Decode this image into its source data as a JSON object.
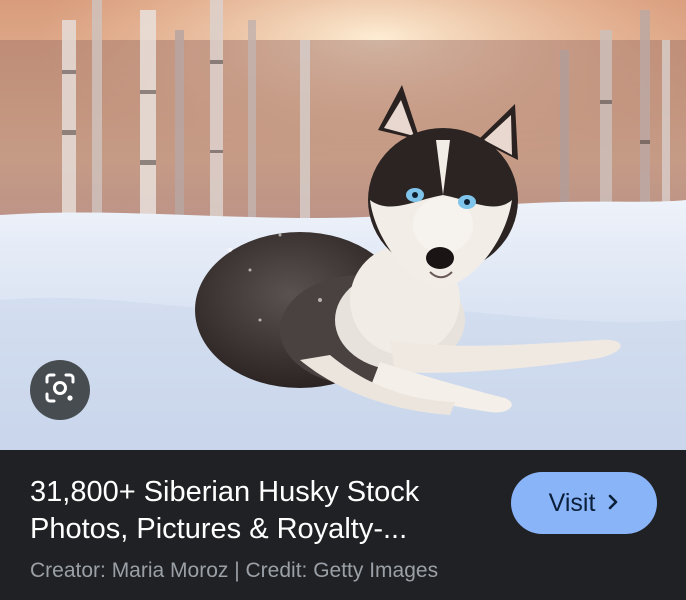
{
  "result": {
    "title_line1": "31,800+ Siberian Husky Stock",
    "title_line2": "Photos, Pictures & Royalty-...",
    "creator_text": "Creator: Maria Moroz | Credit: Getty Images",
    "visit_label": "Visit",
    "visit_icon": "chevron-right-icon",
    "lens_icon": "lens-search-icon",
    "image_subject": "husky-in-snow-photo"
  },
  "colors": {
    "panel_bg": "#202124",
    "title_text": "#ffffff",
    "meta_text": "#9aa0a6",
    "visit_bg": "#8ab4f8"
  }
}
